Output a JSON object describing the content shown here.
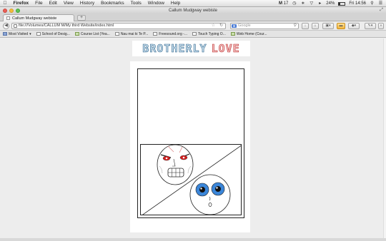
{
  "menubar": {
    "apple": "",
    "app": "Firefox",
    "items": [
      "File",
      "Edit",
      "View",
      "History",
      "Bookmarks",
      "Tools",
      "Window",
      "Help"
    ],
    "tray": {
      "badge_count": "17",
      "battery": "24%",
      "clock": "Fri 14:56"
    }
  },
  "window": {
    "title": "Callum Mudgway webiste"
  },
  "tabs": [
    {
      "label": "Callum Mudgway webiste"
    }
  ],
  "nav": {
    "url": "file:///Volumes/CALLUM M/My third Website/index.html",
    "search_placeholder": "Google"
  },
  "bookmarks": [
    {
      "label": "Most Visited",
      "icon": "folder-icon"
    },
    {
      "label": "School of Desig...",
      "icon": "page-icon"
    },
    {
      "label": "Course List (Yea...",
      "icon": "green-icon"
    },
    {
      "label": "Nau mai ki Te P...",
      "icon": "page-icon"
    },
    {
      "label": "Freesound.org -...",
      "icon": "page-icon"
    },
    {
      "label": "Touch Typing O...",
      "icon": "page-icon"
    },
    {
      "label": "Web Home (Cour...",
      "icon": "green-icon"
    }
  ],
  "page": {
    "banner_word1": "BROTHERLY",
    "banner_word2": "LOVE"
  },
  "colors": {
    "banner_blue": "#2b5f86",
    "banner_red": "#b92b2b",
    "eye_red": "#d11d1d",
    "eye_blue": "#3b86d9"
  }
}
